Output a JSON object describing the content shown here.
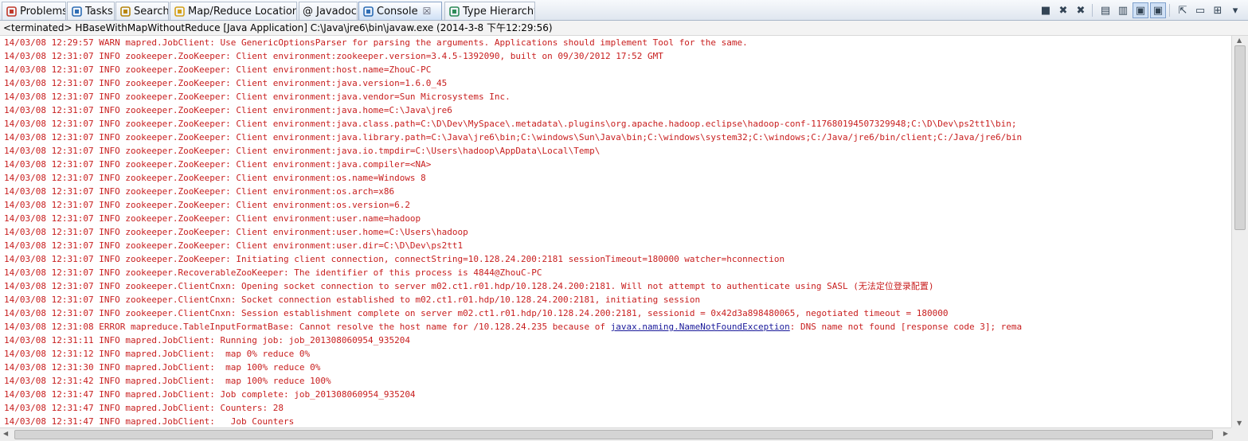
{
  "tabs": [
    {
      "label": "Problems",
      "icon": "problems-icon",
      "color": "#c0392b"
    },
    {
      "label": "Tasks",
      "icon": "tasks-icon",
      "color": "#2e6db4"
    },
    {
      "label": "Search",
      "icon": "search-icon",
      "color": "#b8860b"
    },
    {
      "label": "Map/Reduce Locations",
      "icon": "mapreduce-elephant-icon",
      "color": "#d4a017"
    },
    {
      "label": "@ Javadoc",
      "icon": "javadoc-icon",
      "color": "#555555"
    },
    {
      "label": "Console",
      "icon": "console-icon",
      "color": "#2e6db4",
      "active": true
    },
    {
      "label": "Type Hierarchy",
      "icon": "type-hierarchy-icon",
      "color": "#2e8b57"
    }
  ],
  "toolbar": [
    {
      "name": "terminate-icon",
      "glyph": "■"
    },
    {
      "name": "remove-launch-icon",
      "glyph": "✖"
    },
    {
      "name": "remove-all-terminated-icon",
      "glyph": "✖"
    },
    {
      "name": "separator"
    },
    {
      "name": "clear-console-icon",
      "glyph": "▤"
    },
    {
      "name": "scroll-lock-icon",
      "glyph": "▥"
    },
    {
      "name": "show-console-on-stdout-icon",
      "glyph": "▣",
      "pressed": true
    },
    {
      "name": "show-console-on-stderr-icon",
      "glyph": "▣",
      "pressed": true
    },
    {
      "name": "separator"
    },
    {
      "name": "pin-console-icon",
      "glyph": "⇱"
    },
    {
      "name": "display-selected-console-icon",
      "glyph": "▭"
    },
    {
      "name": "open-console-icon",
      "glyph": "⊞"
    },
    {
      "name": "view-menu-icon",
      "glyph": "▾"
    }
  ],
  "status": "<terminated> HBaseWithMapWithoutReduce [Java Application] C:\\Java\\jre6\\bin\\javaw.exe (2014-3-8 下午12:29:56)",
  "console_lines": [
    "14/03/08 12:29:57 WARN mapred.JobClient: Use GenericOptionsParser for parsing the arguments. Applications should implement Tool for the same.",
    "14/03/08 12:31:07 INFO zookeeper.ZooKeeper: Client environment:zookeeper.version=3.4.5-1392090, built on 09/30/2012 17:52 GMT",
    "14/03/08 12:31:07 INFO zookeeper.ZooKeeper: Client environment:host.name=ZhouC-PC",
    "14/03/08 12:31:07 INFO zookeeper.ZooKeeper: Client environment:java.version=1.6.0_45",
    "14/03/08 12:31:07 INFO zookeeper.ZooKeeper: Client environment:java.vendor=Sun Microsystems Inc.",
    "14/03/08 12:31:07 INFO zookeeper.ZooKeeper: Client environment:java.home=C:\\Java\\jre6",
    "14/03/08 12:31:07 INFO zookeeper.ZooKeeper: Client environment:java.class.path=C:\\D\\Dev\\MySpace\\.metadata\\.plugins\\org.apache.hadoop.eclipse\\hadoop-conf-117680194507329948;C:\\D\\Dev\\ps2tt1\\bin;",
    "14/03/08 12:31:07 INFO zookeeper.ZooKeeper: Client environment:java.library.path=C:\\Java\\jre6\\bin;C:\\windows\\Sun\\Java\\bin;C:\\windows\\system32;C:\\windows;C:/Java/jre6/bin/client;C:/Java/jre6/bin",
    "14/03/08 12:31:07 INFO zookeeper.ZooKeeper: Client environment:java.io.tmpdir=C:\\Users\\hadoop\\AppData\\Local\\Temp\\",
    "14/03/08 12:31:07 INFO zookeeper.ZooKeeper: Client environment:java.compiler=<NA>",
    "14/03/08 12:31:07 INFO zookeeper.ZooKeeper: Client environment:os.name=Windows 8",
    "14/03/08 12:31:07 INFO zookeeper.ZooKeeper: Client environment:os.arch=x86",
    "14/03/08 12:31:07 INFO zookeeper.ZooKeeper: Client environment:os.version=6.2",
    "14/03/08 12:31:07 INFO zookeeper.ZooKeeper: Client environment:user.name=hadoop",
    "14/03/08 12:31:07 INFO zookeeper.ZooKeeper: Client environment:user.home=C:\\Users\\hadoop",
    "14/03/08 12:31:07 INFO zookeeper.ZooKeeper: Client environment:user.dir=C:\\D\\Dev\\ps2tt1",
    "14/03/08 12:31:07 INFO zookeeper.ZooKeeper: Initiating client connection, connectString=10.128.24.200:2181 sessionTimeout=180000 watcher=hconnection",
    "14/03/08 12:31:07 INFO zookeeper.RecoverableZooKeeper: The identifier of this process is 4844@ZhouC-PC",
    "14/03/08 12:31:07 INFO zookeeper.ClientCnxn: Opening socket connection to server m02.ct1.r01.hdp/10.128.24.200:2181. Will not attempt to authenticate using SASL (无法定位登录配置)",
    "14/03/08 12:31:07 INFO zookeeper.ClientCnxn: Socket connection established to m02.ct1.r01.hdp/10.128.24.200:2181, initiating session",
    "14/03/08 12:31:07 INFO zookeeper.ClientCnxn: Session establishment complete on server m02.ct1.r01.hdp/10.128.24.200:2181, sessionid = 0x42d3a898480065, negotiated timeout = 180000",
    "14/03/08 12:31:08 ERROR mapreduce.TableInputFormatBase: Cannot resolve the host name for /10.128.24.235 because of ",
    "14/03/08 12:31:11 INFO mapred.JobClient: Running job: job_201308060954_935204",
    "14/03/08 12:31:12 INFO mapred.JobClient:  map 0% reduce 0%",
    "14/03/08 12:31:30 INFO mapred.JobClient:  map 100% reduce 0%",
    "14/03/08 12:31:42 INFO mapred.JobClient:  map 100% reduce 100%",
    "14/03/08 12:31:47 INFO mapred.JobClient: Job complete: job_201308060954_935204",
    "14/03/08 12:31:47 INFO mapred.JobClient: Counters: 28",
    "14/03/08 12:31:47 INFO mapred.JobClient:   Job Counters"
  ],
  "error_line_index": 21,
  "error_link": "javax.naming.NameNotFoundException",
  "error_suffix": ": DNS name not found [response code 3]; rema"
}
